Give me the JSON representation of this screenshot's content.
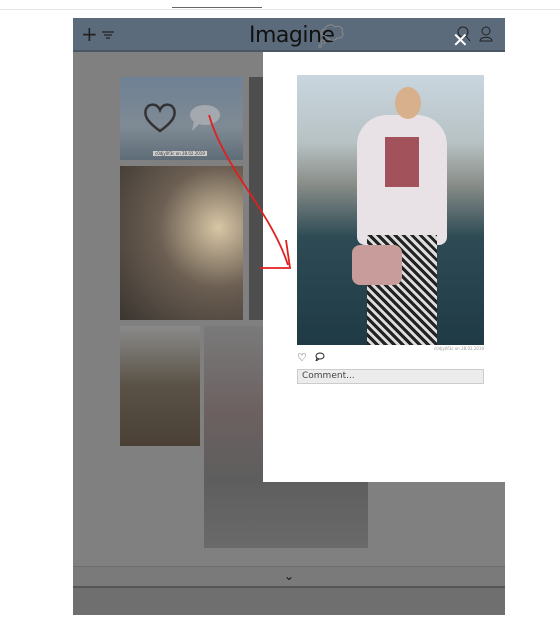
{
  "header": {
    "title": "Imagine",
    "icons": [
      "plus-icon",
      "filter-icon",
      "thought-bubble-icon",
      "search-icon",
      "user-icon"
    ]
  },
  "modal": {
    "caption": "c0djy0f3c on 28.02.2019",
    "comment_placeholder": "Comment...",
    "close_label": "✕"
  },
  "grid": {
    "overlay_caption": "c0djy0f3c on 28.02.2019"
  },
  "footer": {
    "chevron": "⌄"
  },
  "colors": {
    "header": "#5c6b7b",
    "overlay": "#808080",
    "annotation_arrow": "#e02020"
  }
}
